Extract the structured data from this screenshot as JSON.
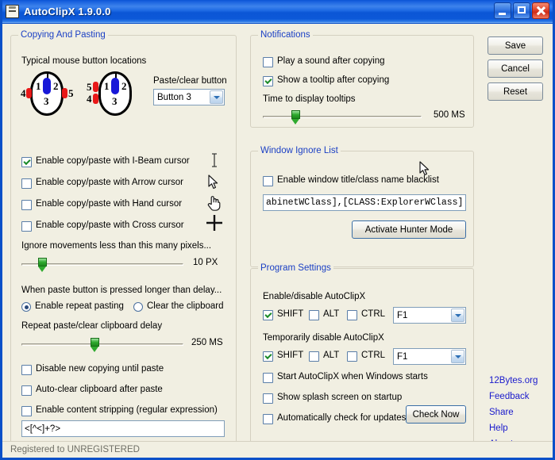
{
  "window": {
    "title": "AutoClipX 1.9.0.0",
    "icon": "clipboard-icon",
    "minimize_label": "",
    "maximize_label": "",
    "close_label": "",
    "titlebar_color": "#0a54d4",
    "accent_color": "#1a3fc4"
  },
  "copying": {
    "legend": "Copying And Pasting",
    "mouse_caption": "Typical mouse button locations",
    "mouse_left": {
      "b1": "1",
      "b2": "2",
      "b3": "3",
      "b4": "4",
      "b5": "5"
    },
    "mouse_right": {
      "b1": "1",
      "b2": "2",
      "b3": "3",
      "b4": "4",
      "b5": "5"
    },
    "paste_button_label": "Paste/clear button",
    "paste_button_value": "Button 3",
    "paste_button_options": [
      "Button 3"
    ],
    "checks": [
      {
        "label": "Enable copy/paste with I-Beam cursor",
        "checked": true,
        "cursor": "ibeam-cursor-icon"
      },
      {
        "label": "Enable copy/paste with Arrow cursor",
        "checked": false,
        "cursor": "arrow-cursor-icon"
      },
      {
        "label": "Enable copy/paste with Hand cursor",
        "checked": false,
        "cursor": "hand-cursor-icon"
      },
      {
        "label": "Enable copy/paste with Cross cursor",
        "checked": false,
        "cursor": "cross-cursor-icon"
      }
    ],
    "ignore_label": "Ignore movements less than this many pixels...",
    "ignore_value": "10 PX",
    "ignore_percent": 8,
    "delay_caption": "When paste button is pressed longer than delay...",
    "radio_repeat": "Enable repeat pasting",
    "radio_clear": "Clear the clipboard",
    "radio_selected": "repeat",
    "repeat_delay_label": "Repeat paste/clear clipboard delay",
    "repeat_delay_value": "250 MS",
    "repeat_delay_percent": 42,
    "disable_new_copy": "Disable new copying until paste",
    "disable_new_copy_checked": false,
    "auto_clear": "Auto-clear clipboard after paste",
    "auto_clear_checked": false,
    "content_stripping": "Enable content stripping (regular expression)",
    "content_stripping_checked": false,
    "regex_value": "<[^<]+?>"
  },
  "notifications": {
    "legend": "Notifications",
    "play_sound": "Play a sound after copying",
    "play_sound_checked": false,
    "show_tooltip": "Show a tooltip after copying",
    "show_tooltip_checked": true,
    "tooltip_time_label": "Time to display tooltips",
    "tooltip_time_value": "500 MS",
    "tooltip_time_percent": 18
  },
  "ignore_list": {
    "legend": "Window Ignore List",
    "enable_label": "Enable window title/class name blacklist",
    "enable_checked": false,
    "blacklist_value": "abinetWClass],[CLASS:ExplorerWClass]",
    "hunter_button": "Activate Hunter Mode"
  },
  "program": {
    "legend": "Program Settings",
    "enable_label": "Enable/disable AutoClipX",
    "enable_hotkey": {
      "shift": "SHIFT",
      "shift_checked": true,
      "alt": "ALT",
      "alt_checked": false,
      "ctrl": "CTRL",
      "ctrl_checked": true,
      "key": "F1",
      "key_options": [
        "F1"
      ]
    },
    "temp_label": "Temporarily disable AutoClipX",
    "temp_hotkey": {
      "shift": "SHIFT",
      "shift_checked": true,
      "alt": "ALT",
      "alt_checked": false,
      "ctrl": "CTRL",
      "ctrl_checked": false,
      "key": "F1",
      "key_options": [
        "F1"
      ]
    },
    "start_with_windows": "Start AutoClipX when Windows starts",
    "start_with_windows_checked": false,
    "splash_screen": "Show splash screen on startup",
    "splash_screen_checked": false,
    "auto_check_updates": "Automatically check for updates",
    "auto_check_updates_checked": false,
    "check_now_button": "Check Now"
  },
  "sidebar": {
    "save": "Save",
    "cancel": "Cancel",
    "reset": "Reset",
    "links": [
      "12Bytes.org",
      "Feedback",
      "Share",
      "Help",
      "About"
    ],
    "link_color": "#1a1acc"
  },
  "statusbar": {
    "text": "Registered to UNREGISTERED"
  }
}
